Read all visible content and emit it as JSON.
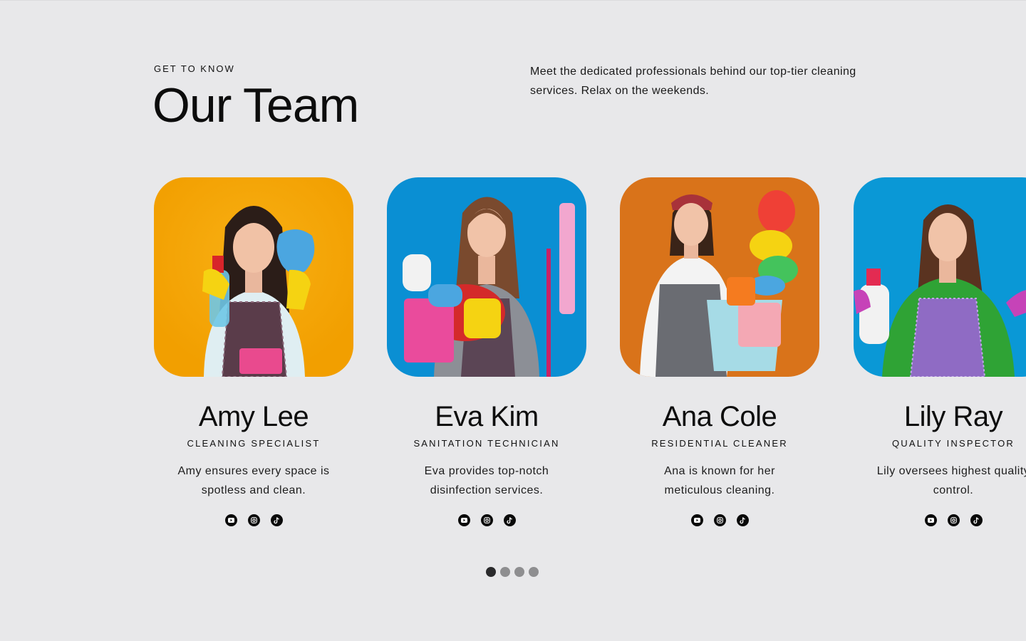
{
  "section": {
    "eyebrow": "GET TO KNOW",
    "title": "Our Team",
    "intro": "Meet the dedicated professionals behind our top-tier cleaning services. Relax on the weekends."
  },
  "team": [
    {
      "name": "Amy Lee",
      "role": "CLEANING SPECIALIST",
      "bio": "Amy ensures every space is spotless and clean.",
      "photo_bg": "#f6a400",
      "socials": [
        "youtube-icon",
        "instagram-icon",
        "tiktok-icon"
      ]
    },
    {
      "name": "Eva Kim",
      "role": "SANITATION TECHNICIAN",
      "bio": "Eva provides top-notch disinfection services.",
      "photo_bg": "#0a8fd3",
      "socials": [
        "youtube-icon",
        "instagram-icon",
        "tiktok-icon"
      ]
    },
    {
      "name": "Ana Cole",
      "role": "RESIDENTIAL CLEANER",
      "bio": "Ana is known for her meticulous cleaning.",
      "photo_bg": "#d9731a",
      "socials": [
        "youtube-icon",
        "instagram-icon",
        "tiktok-icon"
      ]
    },
    {
      "name": "Lily Ray",
      "role": "QUALITY INSPECTOR",
      "bio": "Lily oversees highest quality control.",
      "photo_bg": "#0a98d6",
      "socials": [
        "youtube-icon",
        "instagram-icon",
        "tiktok-icon"
      ]
    }
  ],
  "pagination": {
    "count": 4,
    "active": 1
  },
  "colors": {
    "background": "#e8e8ea",
    "text": "#111111",
    "dot_active": "#2a2a2c",
    "dot_inactive": "#8e8e90"
  }
}
